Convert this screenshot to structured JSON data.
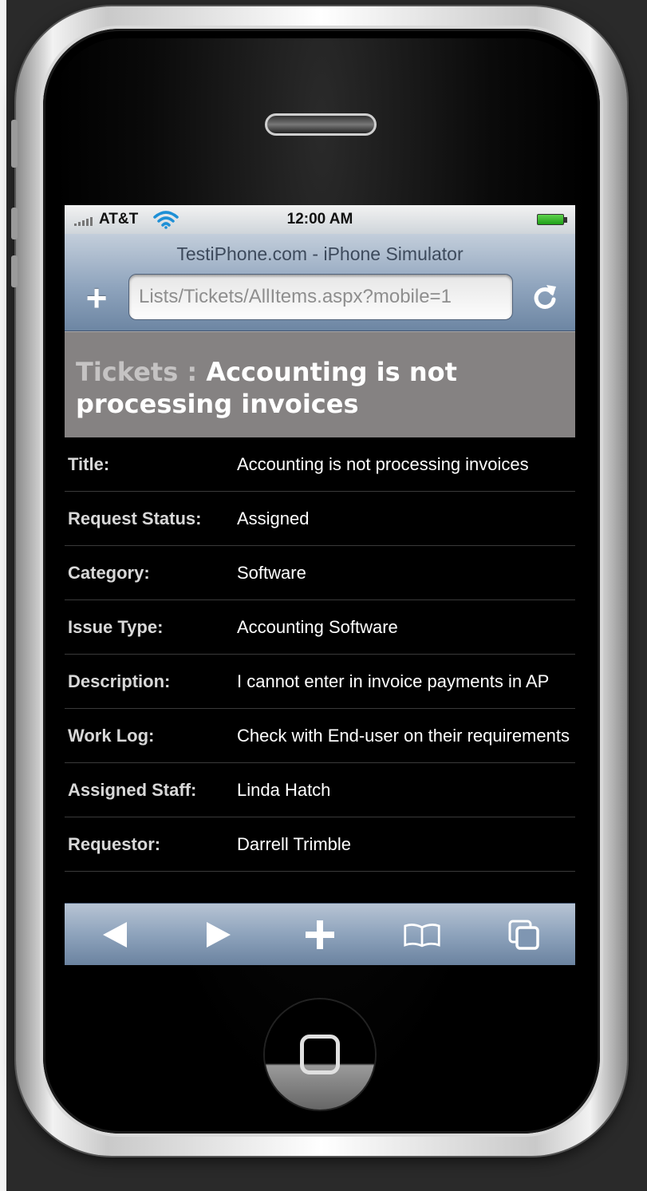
{
  "status_bar": {
    "carrier": "AT&T",
    "time": "12:00 AM"
  },
  "browser": {
    "title": "TestiPhone.com - iPhone Simulator",
    "url": "Lists/Tickets/AllItems.aspx?mobile=1"
  },
  "page": {
    "list_name": "Tickets :",
    "item_title": "Accounting is not processing invoices"
  },
  "fields": [
    {
      "label": "Title:",
      "value": "Accounting is not processing invoices"
    },
    {
      "label": "Request Status:",
      "value": "Assigned"
    },
    {
      "label": "Category:",
      "value": "Software"
    },
    {
      "label": "Issue Type:",
      "value": "Accounting Software"
    },
    {
      "label": "Description:",
      "value": "I cannot enter in invoice payments in AP"
    },
    {
      "label": "Work Log:",
      "value": "Check with End-user on their requirements"
    },
    {
      "label": "Assigned Staff:",
      "value": "Linda Hatch"
    },
    {
      "label": "Requestor:",
      "value": "Darrell Trimble"
    }
  ],
  "toolbar": {
    "icons": [
      "back-arrow-icon",
      "forward-arrow-icon",
      "add-plus-icon",
      "bookmarks-icon",
      "pages-icon"
    ]
  }
}
